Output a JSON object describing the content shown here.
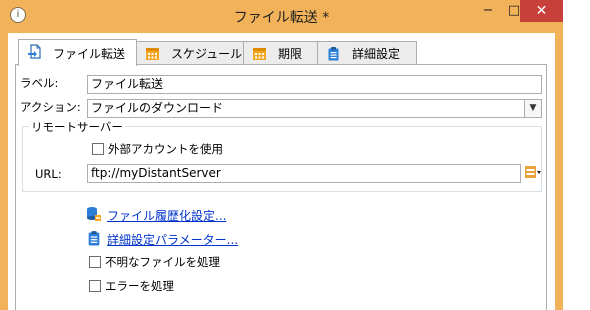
{
  "window": {
    "title": "ファイル転送 *",
    "app_icon_glyph": "i",
    "minimize_glyph": "−",
    "maximize_glyph": "□",
    "close_glyph": "✕"
  },
  "tabs": [
    {
      "label": "ファイル転送",
      "icon": "file-transfer-icon",
      "active": true
    },
    {
      "label": "スケジュール",
      "icon": "calendar-icon",
      "active": false
    },
    {
      "label": "期限",
      "icon": "calendar-icon",
      "active": false
    },
    {
      "label": "詳細設定",
      "icon": "clipboard-icon",
      "active": false
    }
  ],
  "form": {
    "label_caption": "ラベル:",
    "label_value": "ファイル転送",
    "action_caption": "アクション:",
    "action_value": "ファイルのダウンロード",
    "remote_group_title": "リモートサーバー",
    "external_account_label": "外部アカウントを使用",
    "external_account_checked": false,
    "url_caption": "URL:",
    "url_value": "ftp://myDistantServer",
    "history_link": "ファイル履歴化設定...",
    "advanced_params_link": "詳細設定パラメーター...",
    "unknown_files_label": "不明なファイルを処理",
    "unknown_files_checked": false,
    "errors_label": "エラーを処理",
    "errors_checked": false
  },
  "colors": {
    "title_bar": "#f2b25a",
    "close_button": "#c7413a",
    "link": "#0033cc",
    "calendar_orange": "#f5a623"
  }
}
